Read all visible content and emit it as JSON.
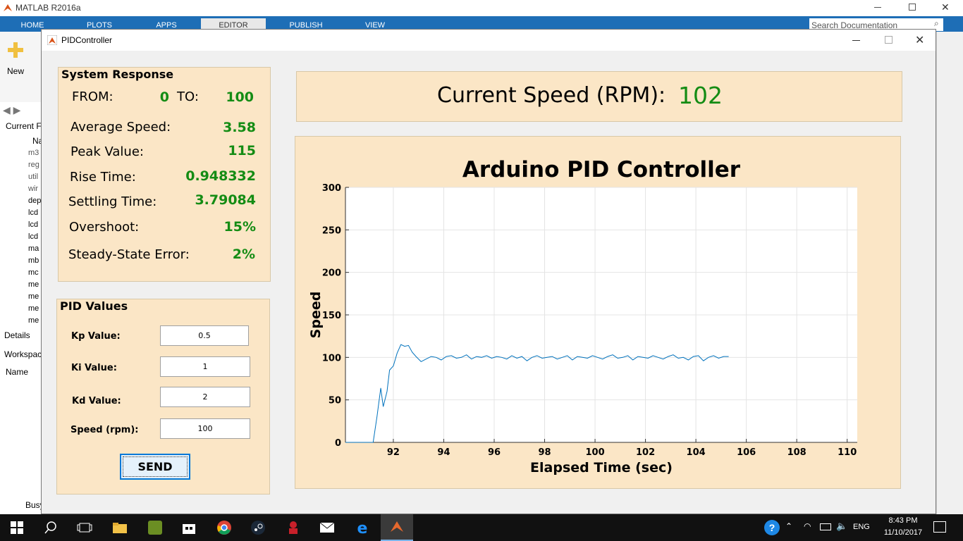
{
  "matlab": {
    "title": "MATLAB R2016a",
    "tabs": [
      "HOME",
      "PLOTS",
      "APPS",
      "EDITOR",
      "PUBLISH",
      "VIEW"
    ],
    "search_placeholder": "Search Documentation",
    "new_label": "New",
    "current_folder_label": "Current F",
    "details_label": "Details",
    "workspace_label": "Workspac",
    "name_col": "Name",
    "status": "Busy",
    "files": [
      "Na",
      "m3",
      "reg",
      "util",
      "wir",
      "dep",
      "lcd",
      "lcd",
      "lcd",
      "ma",
      "mb",
      "mc",
      "me",
      "me",
      "me",
      "me"
    ]
  },
  "window": {
    "title": "PIDController",
    "current_speed_label": "Current Speed (RPM):",
    "current_speed_value": "102"
  },
  "system_response": {
    "title": "System Response",
    "from_label": "FROM:",
    "from_value": "0",
    "to_label": "TO:",
    "to_value": "100",
    "rows": [
      {
        "label": "Average Speed:",
        "value": "3.58"
      },
      {
        "label": "Peak Value:",
        "value": "115"
      },
      {
        "label": "Rise Time:",
        "value": "0.948332"
      },
      {
        "label": "Settling Time:",
        "value": "3.79084"
      },
      {
        "label": "Overshoot:",
        "value": "15%"
      },
      {
        "label": "Steady-State Error:",
        "value": "2%"
      }
    ]
  },
  "pid": {
    "title": "PID Values",
    "kp_label": "Kp Value:",
    "kp": "0.5",
    "ki_label": "Ki Value:",
    "ki": "1",
    "kd_label": "Kd Value:",
    "kd": "2",
    "speed_label": "Speed (rpm):",
    "speed": "100",
    "send_label": "SEND"
  },
  "chart_data": {
    "type": "line",
    "title": "Arduino PID Controller",
    "xlabel": "Elapsed Time (sec)",
    "ylabel": "Speed",
    "xlim": [
      90.1,
      110.4
    ],
    "ylim": [
      0,
      300
    ],
    "xticks": [
      92,
      94,
      96,
      98,
      100,
      102,
      104,
      106,
      108,
      110
    ],
    "yticks": [
      0,
      50,
      100,
      150,
      200,
      250,
      300
    ],
    "grid": true,
    "color": "#0072bd",
    "x": [
      90.1,
      91.2,
      91.35,
      91.5,
      91.6,
      91.75,
      91.85,
      92.0,
      92.15,
      92.3,
      92.45,
      92.6,
      92.75,
      92.9,
      93.1,
      93.3,
      93.5,
      93.7,
      93.9,
      94.1,
      94.3,
      94.5,
      94.7,
      94.9,
      95.1,
      95.3,
      95.5,
      95.7,
      95.9,
      96.1,
      96.3,
      96.5,
      96.7,
      96.9,
      97.1,
      97.3,
      97.5,
      97.7,
      97.9,
      98.1,
      98.3,
      98.5,
      98.7,
      98.9,
      99.1,
      99.3,
      99.5,
      99.7,
      99.9,
      100.1,
      100.3,
      100.5,
      100.7,
      100.9,
      101.1,
      101.3,
      101.5,
      101.7,
      101.9,
      102.1,
      102.3,
      102.5,
      102.7,
      102.9,
      103.1,
      103.3,
      103.5,
      103.7,
      103.9,
      104.1,
      104.3,
      104.5,
      104.7,
      104.9,
      105.1,
      105.3
    ],
    "y": [
      0,
      0,
      30,
      64,
      42,
      60,
      85,
      90,
      105,
      115,
      113,
      114,
      106,
      101,
      95,
      98,
      101,
      100,
      97,
      101,
      102,
      99,
      100,
      103,
      98,
      101,
      100,
      102,
      99,
      101,
      100,
      98,
      102,
      99,
      101,
      96,
      100,
      102,
      99,
      100,
      101,
      98,
      100,
      102,
      97,
      101,
      100,
      99,
      102,
      100,
      98,
      101,
      103,
      99,
      100,
      102,
      97,
      101,
      100,
      99,
      102,
      100,
      98,
      101,
      103,
      99,
      100,
      97,
      101,
      102,
      96,
      100,
      102,
      99,
      101,
      101
    ]
  }
}
